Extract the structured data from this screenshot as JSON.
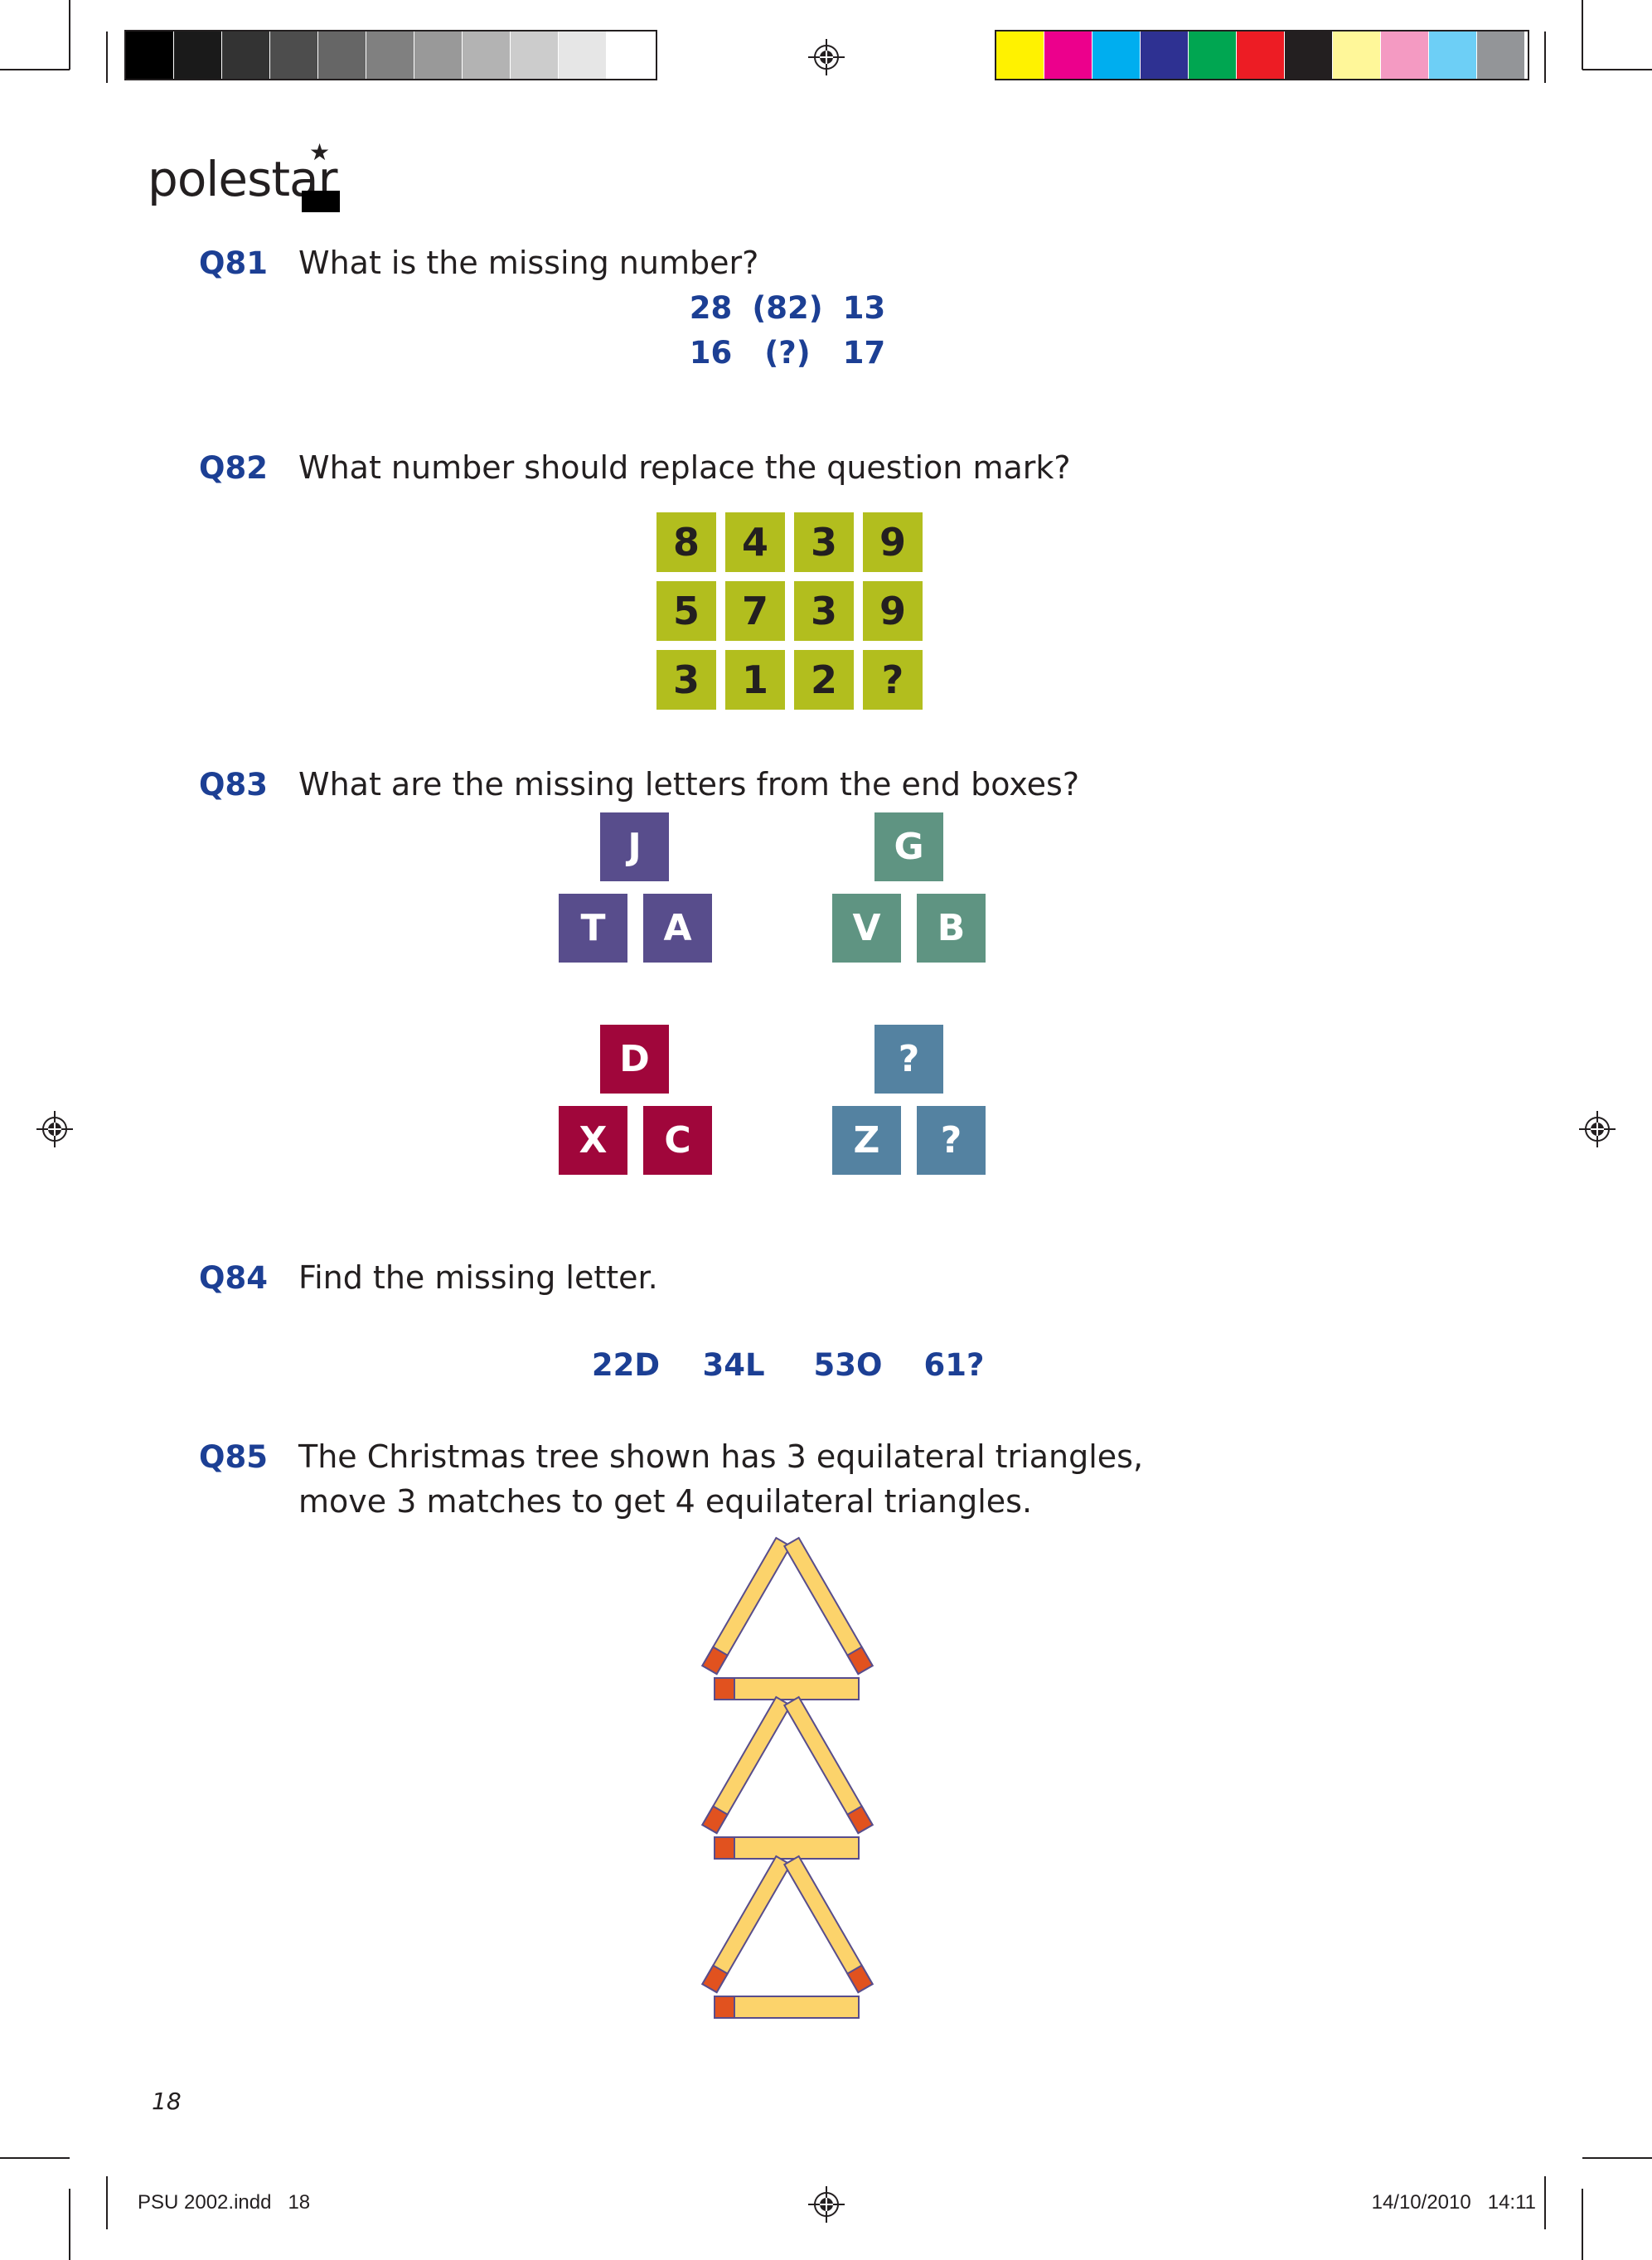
{
  "colors": {
    "question_blue": "#1c3f94",
    "grid_green": "#b2be1e",
    "purple": "#584d8c",
    "teal": "#5f9482",
    "crimson": "#a0063b",
    "steel": "#5482a1",
    "match_wood": "#fcd36b",
    "match_head": "#e1521f"
  },
  "grayscale_bar": [
    "#000000",
    "#1a1a1a",
    "#333333",
    "#4d4d4d",
    "#666666",
    "#808080",
    "#999999",
    "#b3b3b3",
    "#cccccc",
    "#e6e6e6",
    "#ffffff"
  ],
  "color_bar": [
    "#fff200",
    "#ec008c",
    "#00aeef",
    "#2e3192",
    "#00a651",
    "#ed1c24",
    "#231f20",
    "#fff799",
    "#f49ac2",
    "#6dcff6",
    "#939598"
  ],
  "logo": {
    "text": "polestar",
    "icon": "star-icon"
  },
  "q81": {
    "number": "Q81",
    "text": "What is the missing number?",
    "rows": [
      [
        "28",
        "(82)",
        "13"
      ],
      [
        "16",
        "(?)",
        "17"
      ]
    ]
  },
  "q82": {
    "number": "Q82",
    "text": "What number should replace the question mark?",
    "grid": [
      [
        "8",
        "4",
        "3",
        "9"
      ],
      [
        "5",
        "7",
        "3",
        "9"
      ],
      [
        "3",
        "1",
        "2",
        "?"
      ]
    ]
  },
  "q83": {
    "number": "Q83",
    "text": "What are the missing letters from the end boxes?",
    "groups": [
      {
        "top": "J",
        "left": "T",
        "right": "A"
      },
      {
        "top": "G",
        "left": "V",
        "right": "B"
      },
      {
        "top": "D",
        "left": "X",
        "right": "C"
      },
      {
        "top": "?",
        "left": "Z",
        "right": "?"
      }
    ]
  },
  "q84": {
    "number": "Q84",
    "text": "Find the missing letter.",
    "items": [
      "22D",
      "34L",
      "53O",
      "61?"
    ]
  },
  "q85": {
    "number": "Q85",
    "line1": "The Christmas tree shown has 3 equilateral triangles,",
    "line2": "move 3 matches to get 4 equilateral triangles."
  },
  "page_number": "18",
  "footer": {
    "file": "PSU 2002.indd   18",
    "date": "14/10/2010   14:11"
  }
}
